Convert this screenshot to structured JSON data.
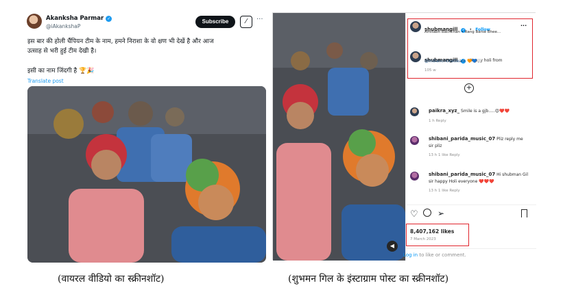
{
  "left_post": {
    "author_name": "Akanksha Parmar",
    "author_handle": "@iAkankshaP",
    "subscribe_label": "Subscribe",
    "more_label": "···",
    "text_line1": "इस बार की होली चैंपियन टीम के नाम, हमने निराशा के वो क्षण भी देखें है और आज",
    "text_line2": "उत्साह से भरी हुई टीम देखी है।",
    "text_line3": "इसी का नाम जिंदगी है 🏆🎉",
    "translate_label": "Translate post"
  },
  "right_post": {
    "header_user": "shubmangill",
    "follow_label": "Follow",
    "header_sub": "Amitabh Bachchan • Rang Barse Bhee...",
    "caption_user": "shubmangill",
    "caption_text": "Happy holi from",
    "caption_mention": "@indiancricketteam",
    "caption_time": "105 w",
    "comments": [
      {
        "user": "paikra_xyz_",
        "text": "Smile is a gjb.....😍❤️❤️",
        "meta": "1 h   Reply"
      },
      {
        "user": "shibani_parida_music_07",
        "text": "Pliz reply me",
        "text2": "sir pliz",
        "meta": "13 h   1 like   Reply"
      },
      {
        "user": "shibani_parida_music_07",
        "text": "Hi shubman Gil",
        "text2": "sir happy Holi everyone ❤️❤️❤️",
        "meta": "13 h   1 like   Reply"
      }
    ],
    "likes": "8,407,162 likes",
    "date": "7 March 2023",
    "login_prefix": "Log in",
    "login_suffix": " to like or comment."
  },
  "captions": {
    "left": "(वायरल वीडियो का स्क्रीनशॉट)",
    "right": "(शुभमन गिल के इंस्टाग्राम पोस्ट का स्क्रीनशॉट)"
  },
  "colors": {
    "highlight": "#e0242c",
    "link": "#1d9bf0",
    "instagram_blue": "#0095f6"
  }
}
